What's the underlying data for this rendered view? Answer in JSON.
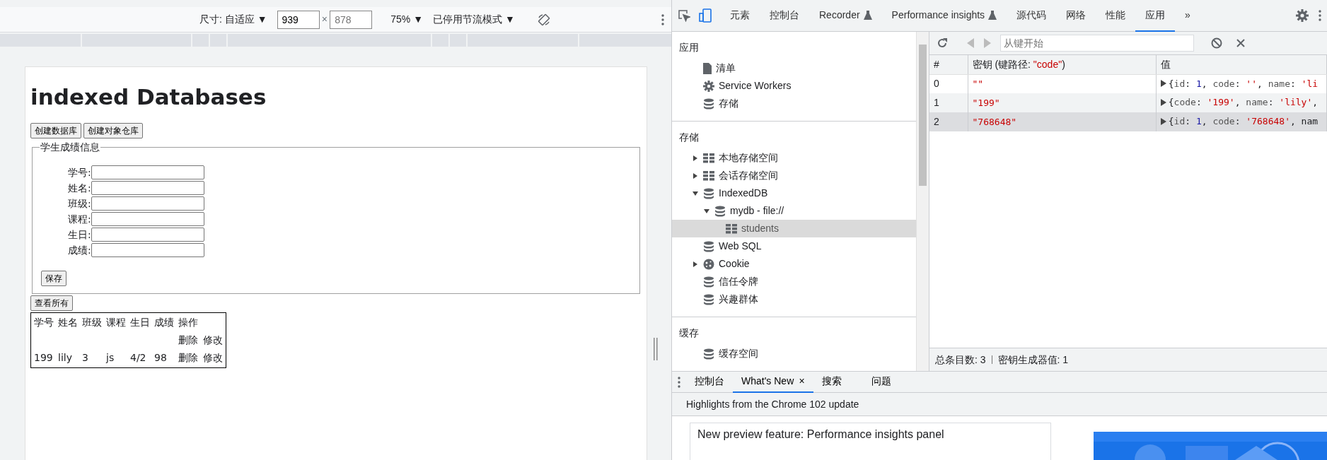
{
  "device_toolbar": {
    "dimensions": "尺寸: 自适应 ▼",
    "width_value": "939",
    "times": "×",
    "height_placeholder": "878",
    "zoom": "75% ▼",
    "throttling": "已停用节流模式 ▼"
  },
  "page": {
    "title": "indexed Databases",
    "buttons": [
      "创建数据库",
      "创建对象仓库"
    ],
    "form": {
      "legend": "学生成绩信息",
      "fields": [
        {
          "label": "学号:"
        },
        {
          "label": "姓名:"
        },
        {
          "label": "班级:"
        },
        {
          "label": "课程:"
        },
        {
          "label": "生日:"
        },
        {
          "label": "成绩:"
        }
      ],
      "save_button": "保存"
    },
    "view_all_button": "查看所有",
    "table": {
      "columns": [
        "学号",
        "姓名",
        "班级",
        "课程",
        "生日",
        "成绩",
        "操作"
      ],
      "rows": [
        {
          "cells": [
            "",
            "",
            "",
            "",
            "",
            ""
          ],
          "links": [
            "删除",
            "修改"
          ]
        },
        {
          "cells": [
            "199",
            "lily",
            "3",
            "js",
            "4/2",
            "98"
          ],
          "links": [
            "删除",
            "修改"
          ]
        }
      ]
    }
  },
  "devtools": {
    "tabs": [
      {
        "label": "元素",
        "experimental": false,
        "selected": false
      },
      {
        "label": "控制台",
        "experimental": false,
        "selected": false
      },
      {
        "label": "Recorder",
        "experimental": true,
        "selected": false
      },
      {
        "label": "Performance insights",
        "experimental": true,
        "selected": false
      },
      {
        "label": "源代码",
        "experimental": false,
        "selected": false
      },
      {
        "label": "网络",
        "experimental": false,
        "selected": false
      },
      {
        "label": "性能",
        "experimental": false,
        "selected": false
      },
      {
        "label": "应用",
        "experimental": false,
        "selected": true
      }
    ],
    "more_tabs": "»",
    "sidebar": {
      "sections": [
        {
          "heading": "应用",
          "items": [
            {
              "label": "清单",
              "kind": "file",
              "selected": false
            },
            {
              "label": "Service Workers",
              "kind": "gear",
              "selected": false
            },
            {
              "label": "存储",
              "kind": "database",
              "selected": false
            }
          ]
        },
        {
          "heading": "存储",
          "items": [
            {
              "label": "本地存储空间",
              "kind": "table",
              "expanded": false,
              "selected": false
            },
            {
              "label": "会话存储空间",
              "kind": "table",
              "expanded": false,
              "selected": false
            },
            {
              "label": "IndexedDB",
              "kind": "database",
              "expanded": true,
              "selected": false,
              "children": [
                {
                  "label": "mydb - file://",
                  "kind": "database",
                  "expanded": true,
                  "selected": false,
                  "children": [
                    {
                      "label": "students",
                      "kind": "table",
                      "selected": true
                    }
                  ]
                }
              ]
            },
            {
              "label": "Web SQL",
              "kind": "database",
              "selected": false
            },
            {
              "label": "Cookie",
              "kind": "cookie",
              "expanded": false,
              "selected": false
            },
            {
              "label": "信任令牌",
              "kind": "database",
              "selected": false
            },
            {
              "label": "兴趣群体",
              "kind": "database",
              "selected": false
            }
          ]
        },
        {
          "heading": "缓存",
          "items": [
            {
              "label": "缓存空间",
              "kind": "database",
              "selected": false
            }
          ]
        }
      ]
    },
    "store": {
      "start_key_placeholder": "从键开始",
      "columns": [
        {
          "label": "#"
        },
        {
          "label": "密钥 (键路径: ",
          "key_path": "\"code\"",
          "suffix": ")"
        },
        {
          "label": "值"
        }
      ],
      "rows": [
        {
          "index": "0",
          "key": "\"\"",
          "value": "{id: 1, code: '', name: 'li",
          "selected": false
        },
        {
          "index": "1",
          "key": "\"199\"",
          "value": "{code: '199', name: 'lily',",
          "selected": false
        },
        {
          "index": "2",
          "key": "\"768648\"",
          "value": "{id: 1, code: '768648', nam",
          "selected": true
        }
      ],
      "status": [
        "总条目数: 3",
        "密钥生成器值: 1"
      ]
    },
    "drawer": {
      "tabs": [
        {
          "label": "控制台",
          "closable": false,
          "selected": false
        },
        {
          "label": "What's New",
          "closable": true,
          "selected": true
        },
        {
          "label": "搜索",
          "closable": false,
          "selected": false
        },
        {
          "label": "问题",
          "closable": false,
          "selected": false
        }
      ],
      "close_mark": "×",
      "subtitle": "Highlights from the Chrome 102 update",
      "article_link": "New preview feature: Performance insights panel"
    }
  }
}
